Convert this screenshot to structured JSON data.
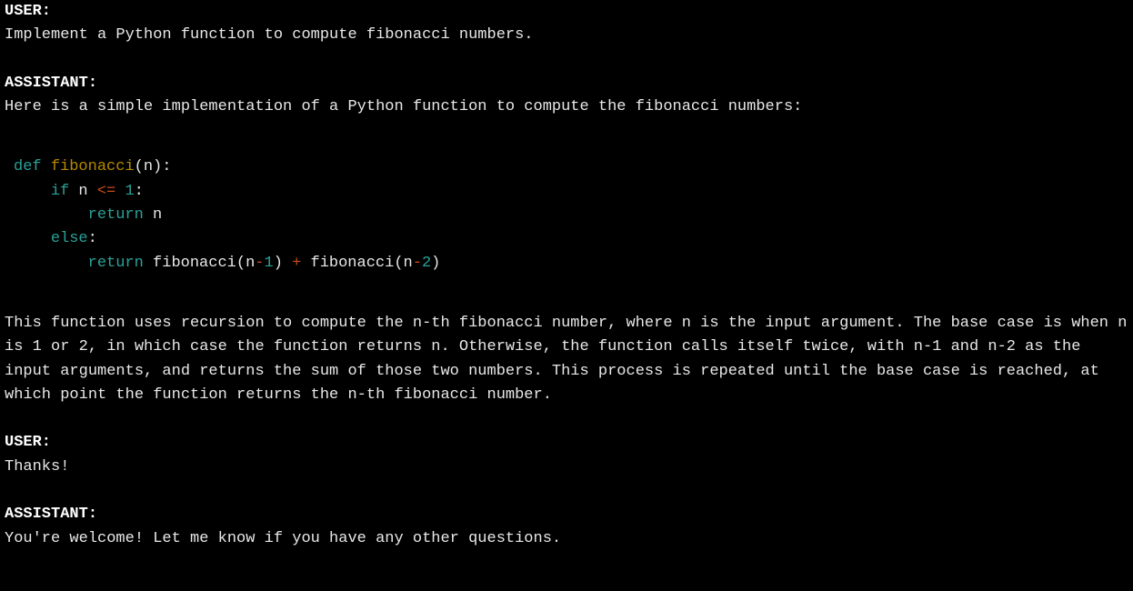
{
  "conversation": {
    "turns": [
      {
        "label": "USER:",
        "content": "Implement a Python function to compute fibonacci numbers."
      },
      {
        "label": "ASSISTANT:",
        "intro": "Here is a simple implementation of a Python function to compute the fibonacci numbers:",
        "explanation": "This function uses recursion to compute the n-th fibonacci number, where n is the input argument. The base case is when n is 1 or 2, in which case the function returns n. Otherwise, the function calls itself twice, with n-1 and n-2 as the input arguments, and returns the sum of those two numbers. This process is repeated until the base case is reached, at which point the function returns the n-th fibonacci number."
      },
      {
        "label": "USER:",
        "content": "Thanks!"
      },
      {
        "label": "ASSISTANT:",
        "content": "You're welcome! Let me know if you have any other questions."
      }
    ],
    "code": {
      "kw_def": "def",
      "fn_name": "fibonacci",
      "param": "n",
      "kw_if": "if",
      "cond_var": "n",
      "cond_op": "<=",
      "cond_val": "1",
      "kw_return1": "return",
      "ret_var": "n",
      "kw_else": "else",
      "kw_return2": "return",
      "call1": "fibonacci",
      "arg1_var": "n",
      "arg1_op": "-",
      "arg1_num": "1",
      "plus": "+",
      "call2": "fibonacci",
      "arg2_var": "n",
      "arg2_op": "-",
      "arg2_num": "2"
    }
  }
}
